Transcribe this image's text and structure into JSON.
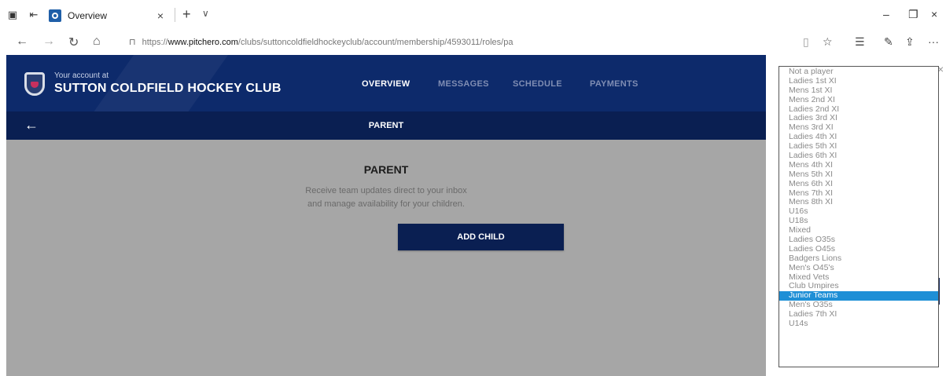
{
  "browser": {
    "tab_title": "Overview",
    "tab_close": "×",
    "new_tab": "+",
    "tab_menu": "∨",
    "win_min": "–",
    "win_max": "❐",
    "win_close": "×",
    "url_lock": "🔒",
    "url_prefix": "https://",
    "url_host": "www.pitchero.com",
    "url_path": "/clubs/suttoncoldfieldhockeyclub/account/membership/4593011/roles/pa",
    "more": "···"
  },
  "header": {
    "account_at": "Your account at",
    "club_name": "SUTTON COLDFIELD HOCKEY CLUB",
    "nav": [
      "OVERVIEW",
      "MESSAGES",
      "SCHEDULE",
      "PAYMENTS"
    ]
  },
  "subbar": {
    "back": "←",
    "title": "PARENT"
  },
  "content": {
    "title": "PARENT",
    "desc_line1": "Receive team updates direct to your inbox",
    "desc_line2": "and manage availability for your children.",
    "button": "ADD CHILD"
  },
  "modal": {
    "close": "×"
  },
  "dropdown": {
    "options": [
      "Not a player",
      "Ladies 1st XI",
      "Mens 1st XI",
      "Mens 2nd XI",
      "Ladies 2nd XI",
      "Ladies 3rd XI",
      "Mens 3rd XI",
      "Ladies 4th XI",
      "Ladies 5th XI",
      "Ladies 6th XI",
      "Mens 4th XI",
      "Mens 5th XI",
      "Mens 6th XI",
      "Mens 7th XI",
      "Mens 8th XI",
      "U16s",
      "U18s",
      "Mixed",
      "Ladies O35s",
      "Ladies O45s",
      "Badgers Lions",
      "Men's O45's",
      "Mixed Vets",
      "Club Umpires",
      "Junior Teams",
      "Men's O35s",
      "Ladies 7th XI",
      "U14s"
    ],
    "selected": "Junior Teams"
  },
  "colors": {
    "header_bg": "#0d2a6b",
    "subbar_bg": "#0a1f52",
    "content_bg": "#a6a6a6",
    "selected_bg": "#1e8fd6"
  }
}
